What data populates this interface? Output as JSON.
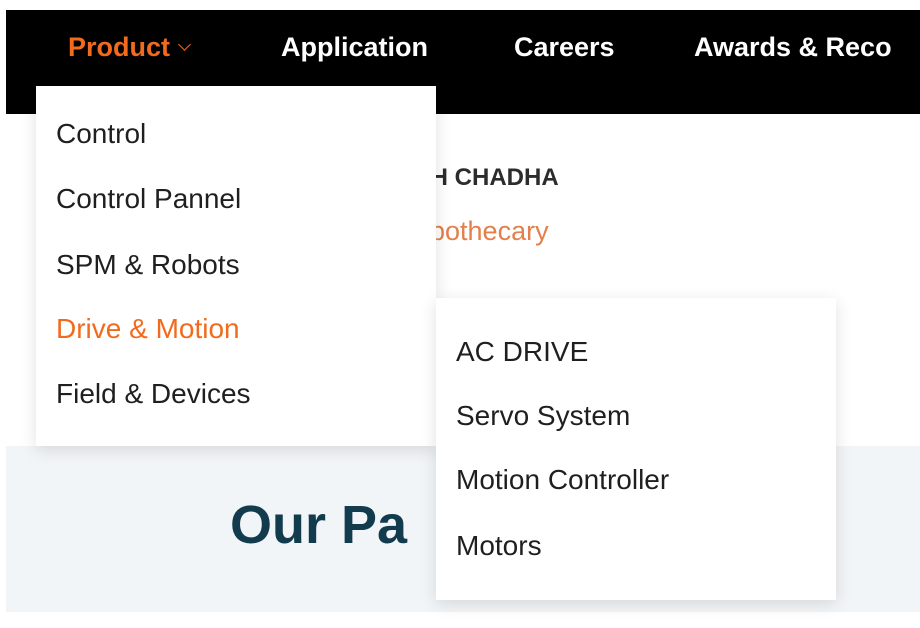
{
  "nav": {
    "items": [
      {
        "label": "Product",
        "active": true
      },
      {
        "label": "Application",
        "active": false
      },
      {
        "label": "Careers",
        "active": false
      },
      {
        "label": "Awards & Reco",
        "active": false
      }
    ]
  },
  "content": {
    "author_name": "GH CHADHA",
    "author_company": "Apothecary",
    "section_title": "Our Pa"
  },
  "product_menu": {
    "items": [
      {
        "label": "Control"
      },
      {
        "label": "Control Pannel"
      },
      {
        "label": "SPM & Robots"
      },
      {
        "label": "Drive & Motion",
        "active": true
      },
      {
        "label": "Field & Devices"
      }
    ]
  },
  "drive_submenu": {
    "items": [
      {
        "label": "AC DRIVE"
      },
      {
        "label": "Servo System"
      },
      {
        "label": "Motion Controller"
      },
      {
        "label": "Motors"
      }
    ]
  },
  "colors": {
    "accent": "#f26b1d",
    "navbar": "#000000",
    "heading": "#123b4d"
  }
}
